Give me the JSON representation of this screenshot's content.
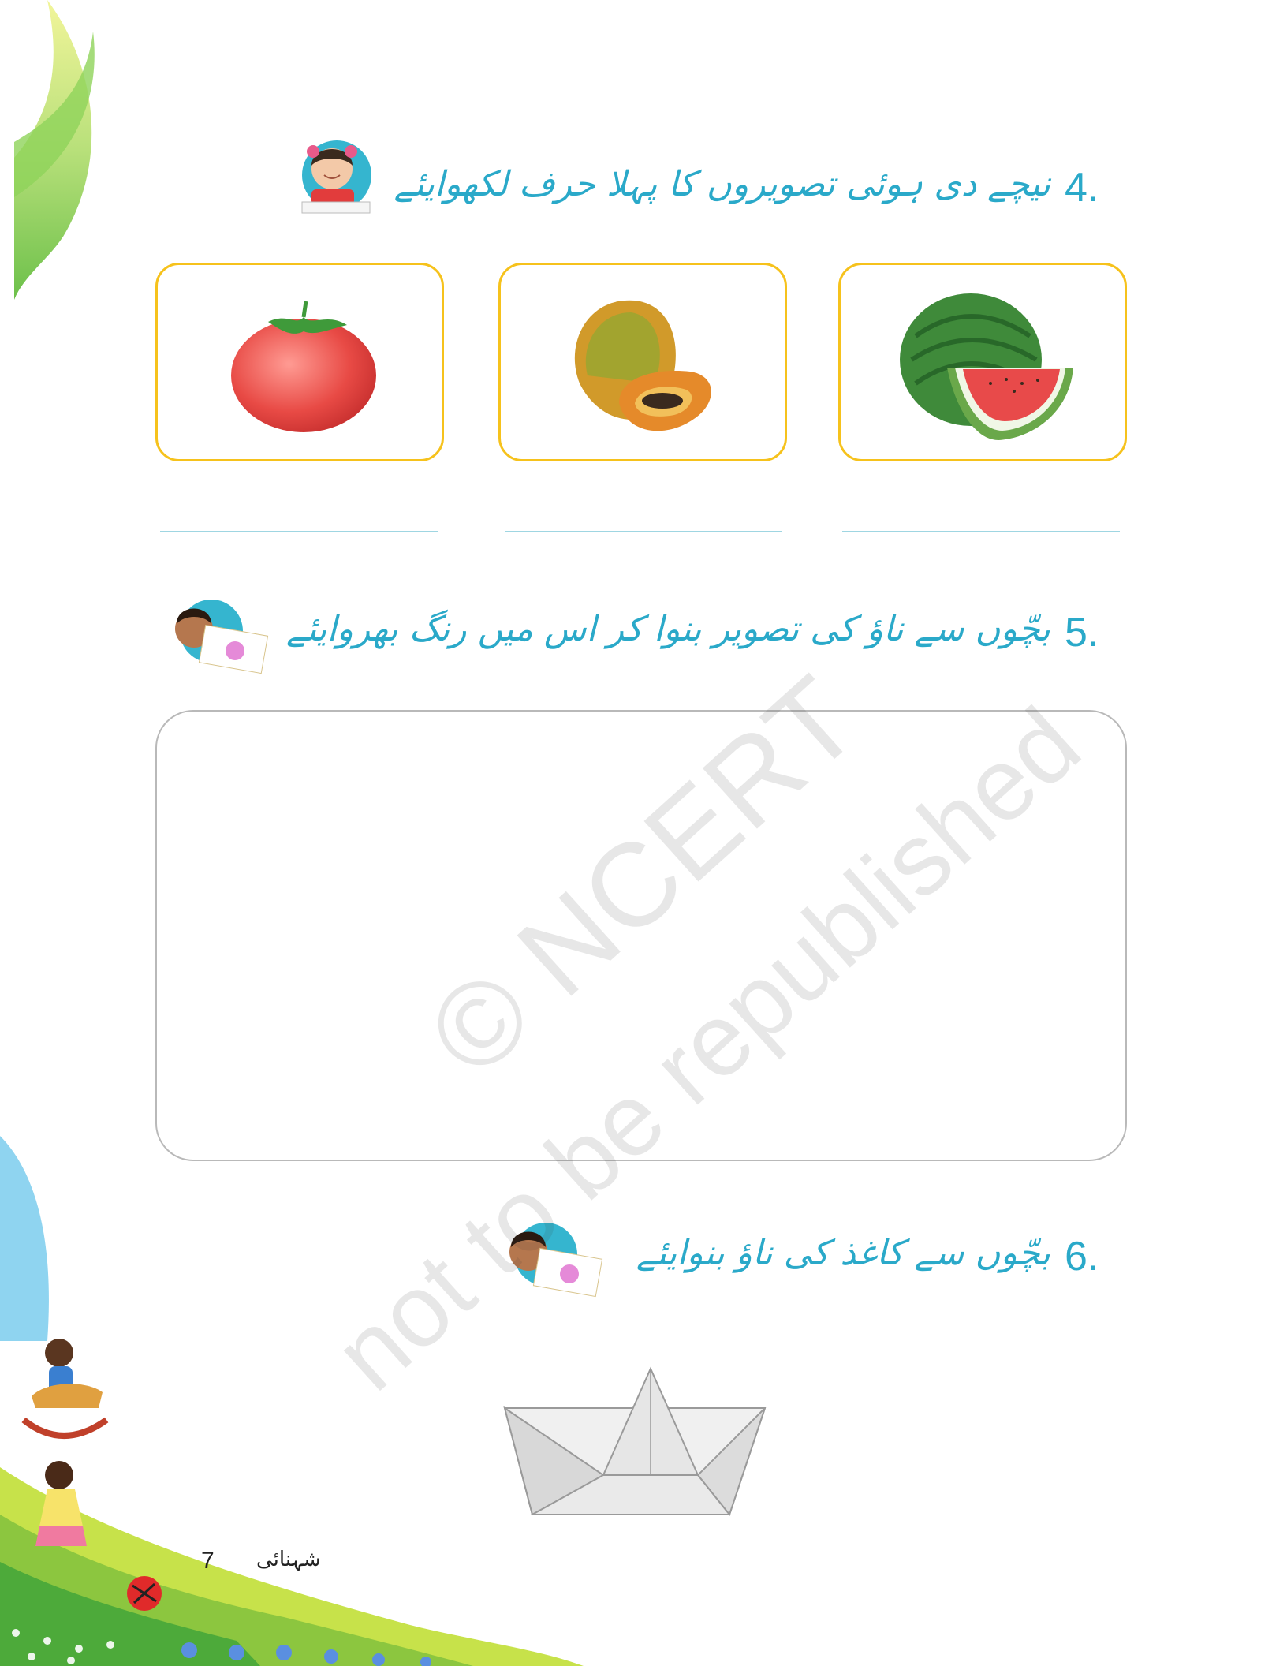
{
  "questions": [
    {
      "number": "4.",
      "text": "نیچے دی ہوئی تصویروں کا پہلا حرف لکھوایئے"
    },
    {
      "number": "5.",
      "text": "بچّوں سے ناؤ کی تصویر بنوا کر اس میں رنگ بھروایئے"
    },
    {
      "number": "6.",
      "text": "بچّوں سے کاغذ کی ناؤ بنوایئے"
    }
  ],
  "images": {
    "card1": "tomato-icon",
    "card2": "papaya-icon",
    "card3": "watermelon-icon",
    "boat": "paper-boat-icon"
  },
  "watermark": {
    "line1": "© NCERT",
    "line2": "not to be republished"
  },
  "footer": {
    "page_number": "7",
    "book_title": "شہنائی"
  },
  "colors": {
    "accent": "#2aa9c9",
    "card_border": "#f6c21c",
    "line": "#9fd6e2"
  }
}
